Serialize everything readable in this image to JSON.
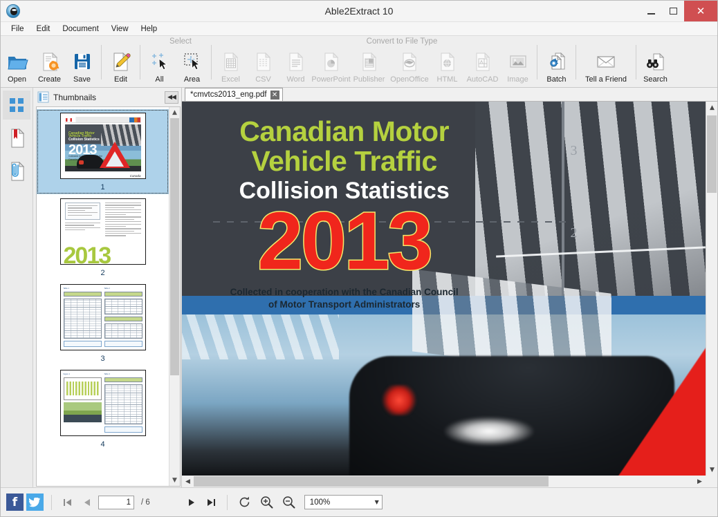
{
  "window": {
    "title": "Able2Extract 10",
    "logo_icon": "app-logo-icon",
    "minimize_label": "Minimize",
    "maximize_label": "Maximize",
    "close_label": "Close"
  },
  "menu": {
    "items": [
      {
        "label": "File"
      },
      {
        "label": "Edit"
      },
      {
        "label": "Document"
      },
      {
        "label": "View"
      },
      {
        "label": "Help"
      }
    ]
  },
  "toolbar": {
    "groups": [
      {
        "label": ""
      },
      {
        "label": "Select"
      },
      {
        "label": "Convert to File Type"
      }
    ],
    "group_select_label": "Select",
    "group_convert_label": "Convert to File Type",
    "buttons": [
      {
        "label": "Open",
        "icon": "open-folder-icon",
        "enabled": true
      },
      {
        "label": "Create",
        "icon": "create-pdf-icon",
        "enabled": true
      },
      {
        "label": "Save",
        "icon": "save-disk-icon",
        "enabled": true
      },
      {
        "label": "Edit",
        "icon": "edit-pencil-icon",
        "enabled": true
      },
      {
        "label": "All",
        "icon": "select-all-icon",
        "enabled": true
      },
      {
        "label": "Area",
        "icon": "select-area-icon",
        "enabled": true
      },
      {
        "label": "Excel",
        "icon": "excel-icon",
        "enabled": false
      },
      {
        "label": "CSV",
        "icon": "csv-icon",
        "enabled": false
      },
      {
        "label": "Word",
        "icon": "word-icon",
        "enabled": false
      },
      {
        "label": "PowerPoint",
        "icon": "powerpoint-icon",
        "enabled": false
      },
      {
        "label": "Publisher",
        "icon": "publisher-icon",
        "enabled": false
      },
      {
        "label": "OpenOffice",
        "icon": "openoffice-icon",
        "enabled": false
      },
      {
        "label": "HTML",
        "icon": "html-icon",
        "enabled": false
      },
      {
        "label": "AutoCAD",
        "icon": "autocad-icon",
        "enabled": false
      },
      {
        "label": "Image",
        "icon": "image-icon",
        "enabled": false
      },
      {
        "label": "Batch",
        "icon": "batch-gear-icon",
        "enabled": true
      },
      {
        "label": "Tell a Friend",
        "icon": "envelope-icon",
        "enabled": true
      },
      {
        "label": "Search",
        "icon": "binoculars-icon",
        "enabled": true
      }
    ]
  },
  "rail": {
    "items": [
      {
        "name": "thumbnails-pane-icon",
        "icon": "grid-icon",
        "active": true
      },
      {
        "name": "bookmarks-pane-icon",
        "icon": "bookmark-icon",
        "active": false
      },
      {
        "name": "attachments-pane-icon",
        "icon": "paperclip-icon",
        "active": false
      }
    ]
  },
  "thumbnails_panel": {
    "title": "Thumbnails",
    "title_icon": "thumbnails-list-icon",
    "collapse_label": "◀◀",
    "pages": [
      {
        "number": "1",
        "selected": true,
        "kind": "cover"
      },
      {
        "number": "2",
        "selected": false,
        "kind": "text"
      },
      {
        "number": "3",
        "selected": false,
        "kind": "tables"
      },
      {
        "number": "4",
        "selected": false,
        "kind": "chart"
      }
    ],
    "scroll_up_icon": "chevron-up-icon",
    "scroll_down_icon": "chevron-down-icon"
  },
  "document": {
    "tab_label": "*cmvtcs2013_eng.pdf",
    "tab_close_label": "✕"
  },
  "pdf_cover": {
    "title_line1": "Canadian Motor",
    "title_line2": "Vehicle Traffic",
    "title_line3": "Collision Statistics",
    "year": "2013",
    "credit_line1": "Collected in cooperation with the Canadian Council",
    "credit_line2": "of Motor Transport Administrators",
    "lane_number_top": "3",
    "lane_number_bottom": "2",
    "colors": {
      "title_green": "#b5d13f",
      "title_white": "#ffffff",
      "year_red": "#f0261c",
      "year_outline": "#f6e96a",
      "band_blue": "#2f6fae",
      "sky_gray": "#3c4047"
    }
  },
  "scrollbars": {
    "viewer_up_icon": "chevron-up-icon",
    "viewer_down_icon": "chevron-down-icon",
    "viewer_left_icon": "chevron-left-icon",
    "viewer_right_icon": "chevron-right-icon"
  },
  "statusbar": {
    "facebook_label": "f",
    "twitter_label": "t",
    "first_page_icon": "first-page-icon",
    "prev_page_icon": "prev-page-icon",
    "next_page_icon": "next-page-icon",
    "last_page_icon": "last-page-icon",
    "page_value": "1",
    "page_total": "/ 6",
    "page_placeholder": "1",
    "rotate_icon": "rotate-icon",
    "zoom_in_icon": "zoom-in-icon",
    "zoom_out_icon": "zoom-out-icon",
    "zoom_value": "100%",
    "zoom_caret": "▼"
  }
}
